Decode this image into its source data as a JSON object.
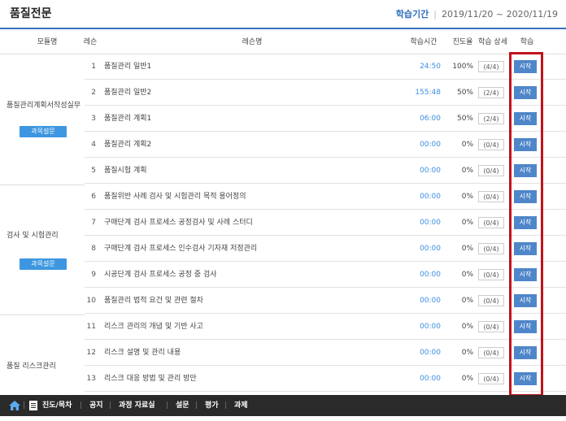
{
  "header": {
    "title": "품질전문",
    "period_label": "학습기간",
    "period_value": "2019/11/20 ~ 2020/11/19"
  },
  "table": {
    "columns": {
      "module": "모듈명",
      "lesson": "레슨",
      "lesson_name": "레슨명",
      "study_time": "학습시간",
      "progress": "진도율",
      "detail": "학습 상세",
      "study": "학습"
    },
    "modules": [
      {
        "name": "품질관리계획서작성실무",
        "survey": "과목설문"
      },
      {
        "name": "검사 및 시험관리",
        "survey": "과목설문"
      },
      {
        "name": "품질 리스크관리"
      }
    ],
    "rows": [
      {
        "no": "1",
        "name": "품질관리 일반1",
        "time": "24:50",
        "progress": "100%",
        "detail": "(4/4)",
        "action": "시작"
      },
      {
        "no": "2",
        "name": "품질관리 일반2",
        "time": "155:48",
        "progress": "50%",
        "detail": "(2/4)",
        "action": "시작"
      },
      {
        "no": "3",
        "name": "품질관리 계획1",
        "time": "06:00",
        "progress": "50%",
        "detail": "(2/4)",
        "action": "시작"
      },
      {
        "no": "4",
        "name": "품질관리 계획2",
        "time": "00:00",
        "progress": "0%",
        "detail": "(0/4)",
        "action": "시작"
      },
      {
        "no": "5",
        "name": "품질시험 계획",
        "time": "00:00",
        "progress": "0%",
        "detail": "(0/4)",
        "action": "시작"
      },
      {
        "no": "6",
        "name": "품질위반 사례 검사 및 시험관리 목적 용어정의",
        "time": "00:00",
        "progress": "0%",
        "detail": "(0/4)",
        "action": "시작"
      },
      {
        "no": "7",
        "name": "구매단계 검사 프로세스 공정검사 및 사례 스터디",
        "time": "00:00",
        "progress": "0%",
        "detail": "(0/4)",
        "action": "시작"
      },
      {
        "no": "8",
        "name": "구매단계 검사 프로세스 인수검사 기자재 저정관리",
        "time": "00:00",
        "progress": "0%",
        "detail": "(0/4)",
        "action": "시작"
      },
      {
        "no": "9",
        "name": "시공단계 검사 프로세스 공정 중 검사",
        "time": "00:00",
        "progress": "0%",
        "detail": "(0/4)",
        "action": "시작"
      },
      {
        "no": "10",
        "name": "품질관리 법적 요건 및 관련 절차",
        "time": "00:00",
        "progress": "0%",
        "detail": "(0/4)",
        "action": "시작"
      },
      {
        "no": "11",
        "name": "리스크 관리의 개념 및 기반 사고",
        "time": "00:00",
        "progress": "0%",
        "detail": "(0/4)",
        "action": "시작"
      },
      {
        "no": "12",
        "name": "리스크 설명 및 관리 내용",
        "time": "00:00",
        "progress": "0%",
        "detail": "(0/4)",
        "action": "시작"
      },
      {
        "no": "13",
        "name": "리스크 대응 방법 및 관리 방안",
        "time": "00:00",
        "progress": "0%",
        "detail": "(0/4)",
        "action": "시작"
      }
    ]
  },
  "bottom_nav": {
    "toc": "진도/목차",
    "notice": "공지",
    "materials": "과정 자료실",
    "survey": "설문",
    "evaluation": "평가",
    "assignment": "과제"
  },
  "colors": {
    "accent": "#3a6ebd",
    "start_button": "#4f86c9",
    "survey_button": "#3d97e0",
    "highlight": "#c0141b",
    "bottom_bar": "#2a2a2a"
  }
}
